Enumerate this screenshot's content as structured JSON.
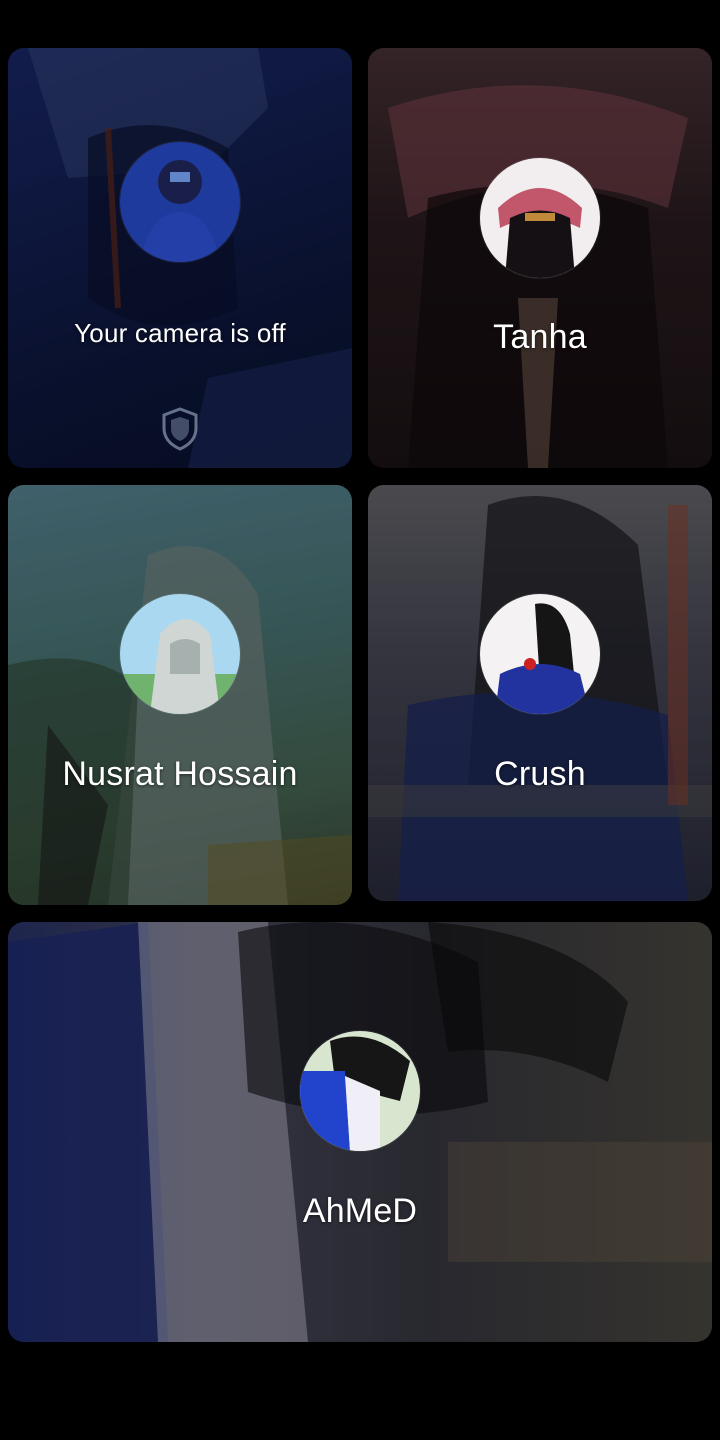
{
  "participants": [
    {
      "id": "self",
      "label": "Your camera is off",
      "camera_off": true,
      "theme": "#1a2a6c"
    },
    {
      "id": "tanha",
      "label": "Tanha",
      "theme": "#3a1c22"
    },
    {
      "id": "nusrat",
      "label": "Nusrat Hossain",
      "theme": "#4a6a6a"
    },
    {
      "id": "crush",
      "label": "Crush",
      "theme": "#3c3f55"
    },
    {
      "id": "ahmed",
      "label": "AhMeD",
      "theme": "#2b2b3a"
    }
  ],
  "icons": {
    "shield": "shield-icon"
  }
}
